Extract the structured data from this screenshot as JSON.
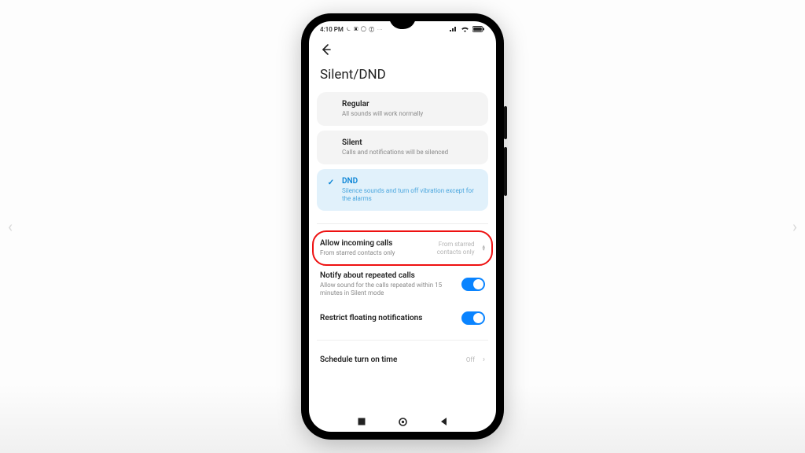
{
  "status": {
    "time": "4:10 PM",
    "icons_left": "⏾ ▣ ◯ ⓕ ⋯"
  },
  "page_title": "Silent/DND",
  "modes": [
    {
      "title": "Regular",
      "sub": "All sounds will work normally",
      "active": false
    },
    {
      "title": "Silent",
      "sub": "Calls and notifications will be silenced",
      "active": false
    },
    {
      "title": "DND",
      "sub": "Silence sounds and turn off vibration except for the alarms",
      "active": true
    }
  ],
  "rows": {
    "allow_calls": {
      "title": "Allow incoming calls",
      "sub": "From starred contacts only",
      "value": "From starred contacts only"
    },
    "repeated": {
      "title": "Notify about repeated calls",
      "sub": "Allow sound for the calls repeated within 15 minutes in Silent mode"
    },
    "restrict": {
      "title": "Restrict floating notifications"
    },
    "schedule": {
      "title": "Schedule turn on time",
      "value": "Off"
    }
  }
}
